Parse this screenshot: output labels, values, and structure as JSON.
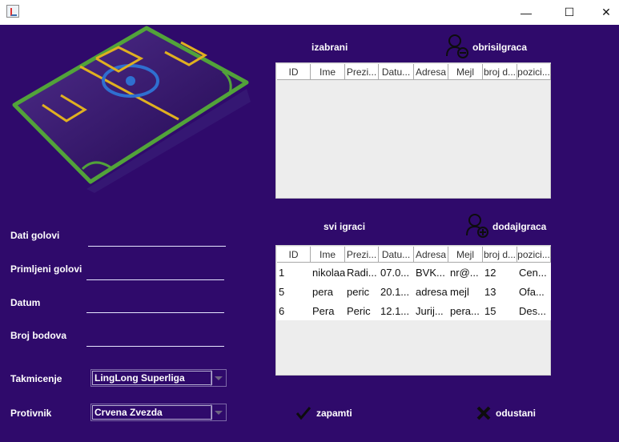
{
  "window": {
    "icon": "java-app-icon",
    "controls": {
      "minimize": "—",
      "maximize": "☐",
      "close": "✕"
    }
  },
  "form": {
    "dati_golovi": {
      "label": "Dati golovi",
      "value": ""
    },
    "primljeni_golovi": {
      "label": "Primljeni golovi",
      "value": ""
    },
    "datum": {
      "label": "Datum",
      "value": ""
    },
    "broj_bodova": {
      "label": "Broj bodova",
      "value": ""
    },
    "takmicenje": {
      "label": "Takmicenje",
      "selected": "LingLong Superliga"
    },
    "protivnik": {
      "label": "Protivnik",
      "selected": "Crvena Zvezda"
    }
  },
  "izabrani": {
    "title": "izabrani",
    "action_label": "obrisiIgraca",
    "action_icon": "remove-user-icon",
    "columns": [
      "ID",
      "Ime",
      "Prezi...",
      "Datu...",
      "Adresa",
      "Mejl",
      "broj d...",
      "pozici..."
    ],
    "rows": []
  },
  "svi_igraci": {
    "title": "svi igraci",
    "action_label": "dodajIgraca",
    "action_icon": "add-user-icon",
    "columns": [
      "ID",
      "Ime",
      "Prezi...",
      "Datu...",
      "Adresa",
      "Mejl",
      "broj d...",
      "pozici..."
    ],
    "rows": [
      [
        "1",
        "nikolaa",
        "Radi...",
        "07.0...",
        "BVK...",
        "nr@...",
        "12",
        "Cen..."
      ],
      [
        "5",
        "pera",
        "peric",
        "20.1...",
        "adresa",
        "mejl",
        "13",
        "Ofa..."
      ],
      [
        "6",
        "Pera",
        "Peric",
        "12.1...",
        "Jurij...",
        "pera...",
        "15",
        "Des..."
      ]
    ]
  },
  "actions": {
    "save": {
      "label": "zapamti",
      "icon": "checkmark-icon"
    },
    "cancel": {
      "label": "odustani",
      "icon": "x-mark-icon"
    }
  },
  "colors": {
    "background": "#2f0a6b",
    "field_line": "#52a33a",
    "goal_box": "#e0b020",
    "center_circle": "#2f6fd0"
  }
}
